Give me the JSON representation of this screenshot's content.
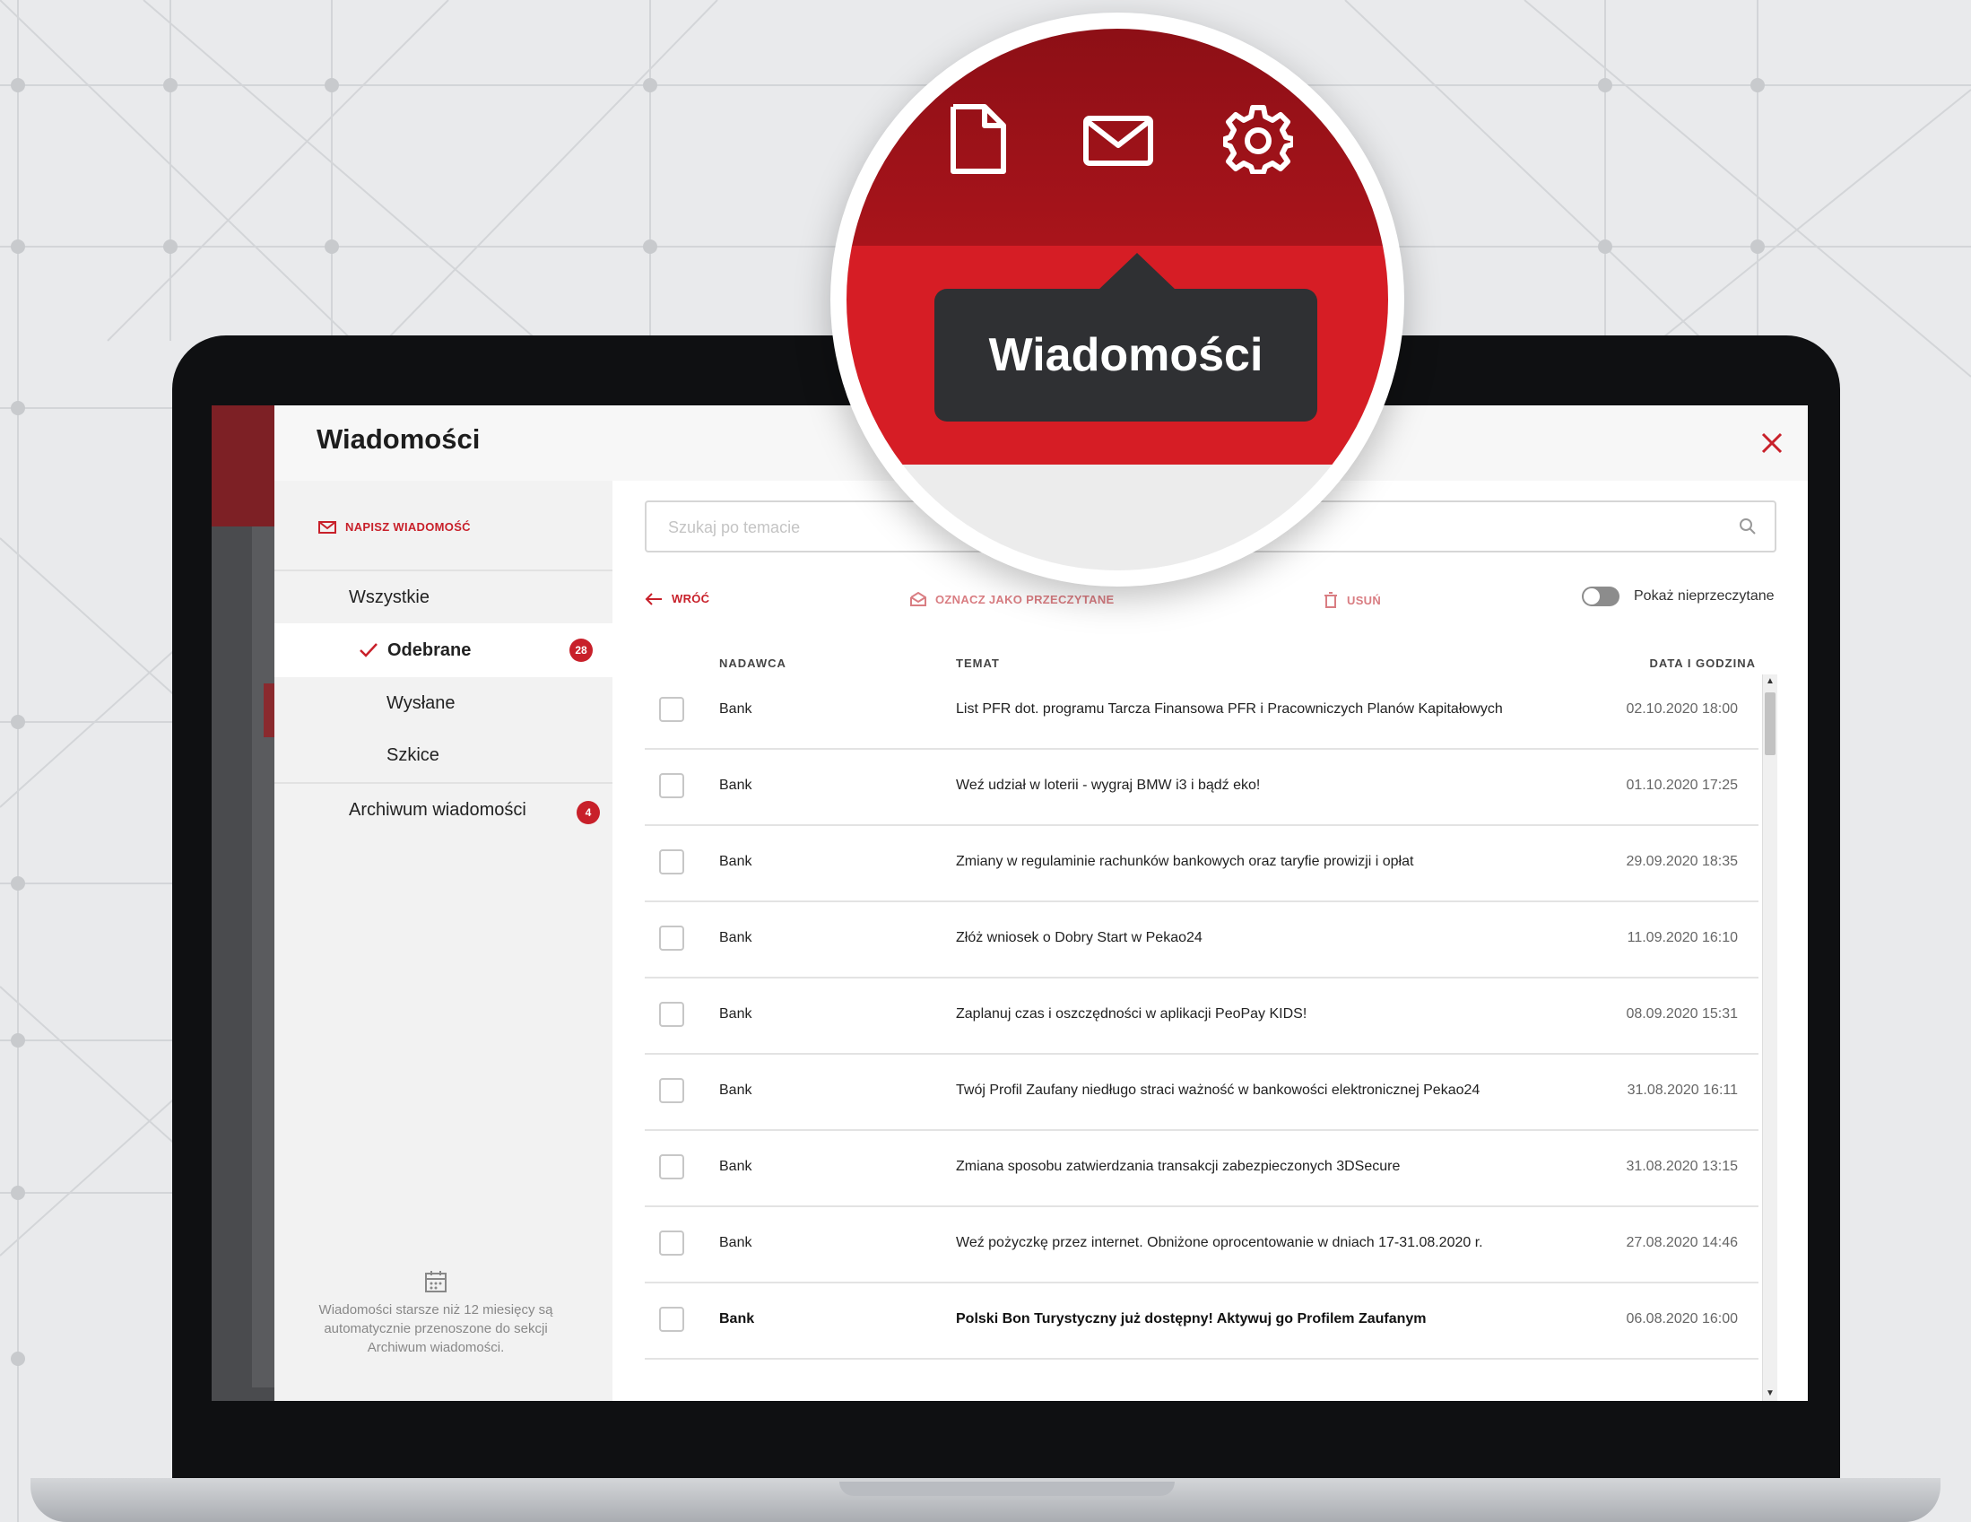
{
  "modal": {
    "title": "Wiadomości",
    "compose_label": "NAPISZ WIADOMOŚĆ"
  },
  "sidebar": {
    "items": [
      {
        "label": "Wszystkie"
      },
      {
        "label": "Odebrane",
        "badge": "28",
        "selected": true
      },
      {
        "label": "Wysłane"
      },
      {
        "label": "Szkice"
      },
      {
        "label": "Archiwum wiadomości",
        "badge": "4"
      }
    ],
    "footer_note": "Wiadomości starsze niż 12 miesięcy są automatycznie przenoszone do sekcji Archiwum wiadomości."
  },
  "search": {
    "placeholder": "Szukaj po temacie",
    "value": ""
  },
  "toolbar": {
    "back_label": "WRÓĆ",
    "mark_read_label": "OZNACZ JAKO PRZECZYTANE",
    "delete_label": "USUŃ",
    "toggle_label": "Pokaż nieprzeczytane"
  },
  "table": {
    "columns": [
      "NADAWCA",
      "TEMAT",
      "DATA I GODZINA"
    ],
    "rows": [
      {
        "sender": "Bank",
        "subject": "List PFR dot. programu Tarcza Finansowa PFR i Pracowniczych Planów Kapitałowych",
        "date": "02.10.2020 18:00",
        "unread": false
      },
      {
        "sender": "Bank",
        "subject": "Weź udział w loterii - wygraj BMW i3 i bądź eko!",
        "date": "01.10.2020 17:25",
        "unread": false
      },
      {
        "sender": "Bank",
        "subject": "Zmiany w regulaminie rachunków bankowych oraz taryfie prowizji i opłat",
        "date": "29.09.2020 18:35",
        "unread": false
      },
      {
        "sender": "Bank",
        "subject": "Złóż wniosek o Dobry Start w Pekao24",
        "date": "11.09.2020 16:10",
        "unread": false
      },
      {
        "sender": "Bank",
        "subject": "Zaplanuj czas i oszczędności w aplikacji PeoPay KIDS!",
        "date": "08.09.2020 15:31",
        "unread": false
      },
      {
        "sender": "Bank",
        "subject": "Twój Profil Zaufany niedługo straci ważność w bankowości elektronicznej Pekao24",
        "date": "31.08.2020 16:11",
        "unread": false
      },
      {
        "sender": "Bank",
        "subject": "Zmiana sposobu zatwierdzania transakcji zabezpieczonych 3DSecure",
        "date": "31.08.2020 13:15",
        "unread": false
      },
      {
        "sender": "Bank",
        "subject": "Weź pożyczkę przez internet. Obniżone oprocentowanie w dniach 17-31.08.2020 r.",
        "date": "27.08.2020 14:46",
        "unread": false
      },
      {
        "sender": "Bank",
        "subject": "Polski Bon Turystyczny już dostępny! Aktywuj go Profilem Zaufanym",
        "date": "06.08.2020 16:00",
        "unread": true
      }
    ]
  },
  "magnifier": {
    "tooltip": "Wiadomości",
    "icons": [
      "document-icon",
      "envelope-icon",
      "gear-icon"
    ]
  },
  "colors": {
    "accent": "#c8202a",
    "header_dark_red": "#a9141b",
    "header_red": "#d61d25",
    "tooltip_bg": "#2f3033"
  }
}
